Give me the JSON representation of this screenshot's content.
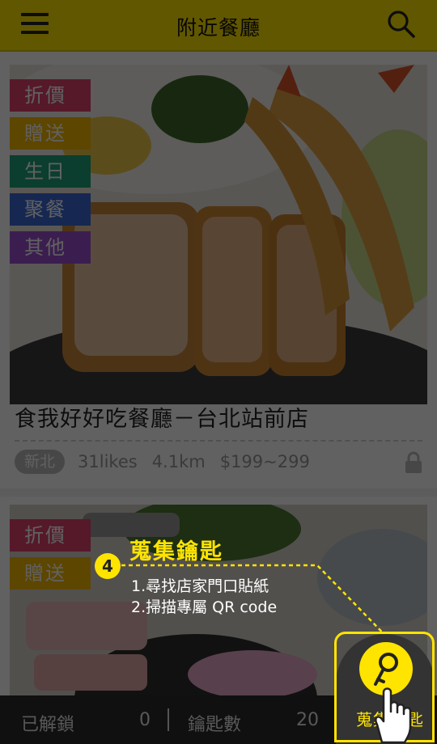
{
  "header": {
    "title": "附近餐廳",
    "menu_icon": "hamburger-menu-icon",
    "search_icon": "search-icon"
  },
  "cards": [
    {
      "tags": [
        {
          "label": "折價",
          "color": "#e2436e"
        },
        {
          "label": "贈送",
          "color": "#f5b700"
        },
        {
          "label": "生日",
          "color": "#1fa37a"
        },
        {
          "label": "聚餐",
          "color": "#3a69d6"
        },
        {
          "label": "其他",
          "color": "#9b4fcf"
        }
      ],
      "title": "食我好好吃餐廳－台北站前店",
      "region": "新北",
      "likes": "31likes",
      "distance": "4.1km",
      "price": "$199~299",
      "lock_icon": "lock-icon"
    },
    {
      "tags": [
        {
          "label": "折價",
          "color": "#e2436e"
        },
        {
          "label": "贈送",
          "color": "#f5b700"
        }
      ]
    }
  ],
  "tutorial": {
    "step": "4",
    "title": "蒐集鑰匙",
    "line1": "1.尋找店家門口貼紙",
    "line2": "2.掃描專屬 QR code"
  },
  "bottom_bar": {
    "unlocked_label": "已解鎖",
    "unlocked_value": "0",
    "keys_label": "鑰匙數",
    "keys_value": "20"
  },
  "fab": {
    "label": "蒐集鑰匙",
    "icon": "key-icon",
    "hand_icon": "pointing-hand-icon"
  },
  "colors": {
    "brand": "#ffe400",
    "overlay": "rgba(0,0,0,0.62)"
  }
}
